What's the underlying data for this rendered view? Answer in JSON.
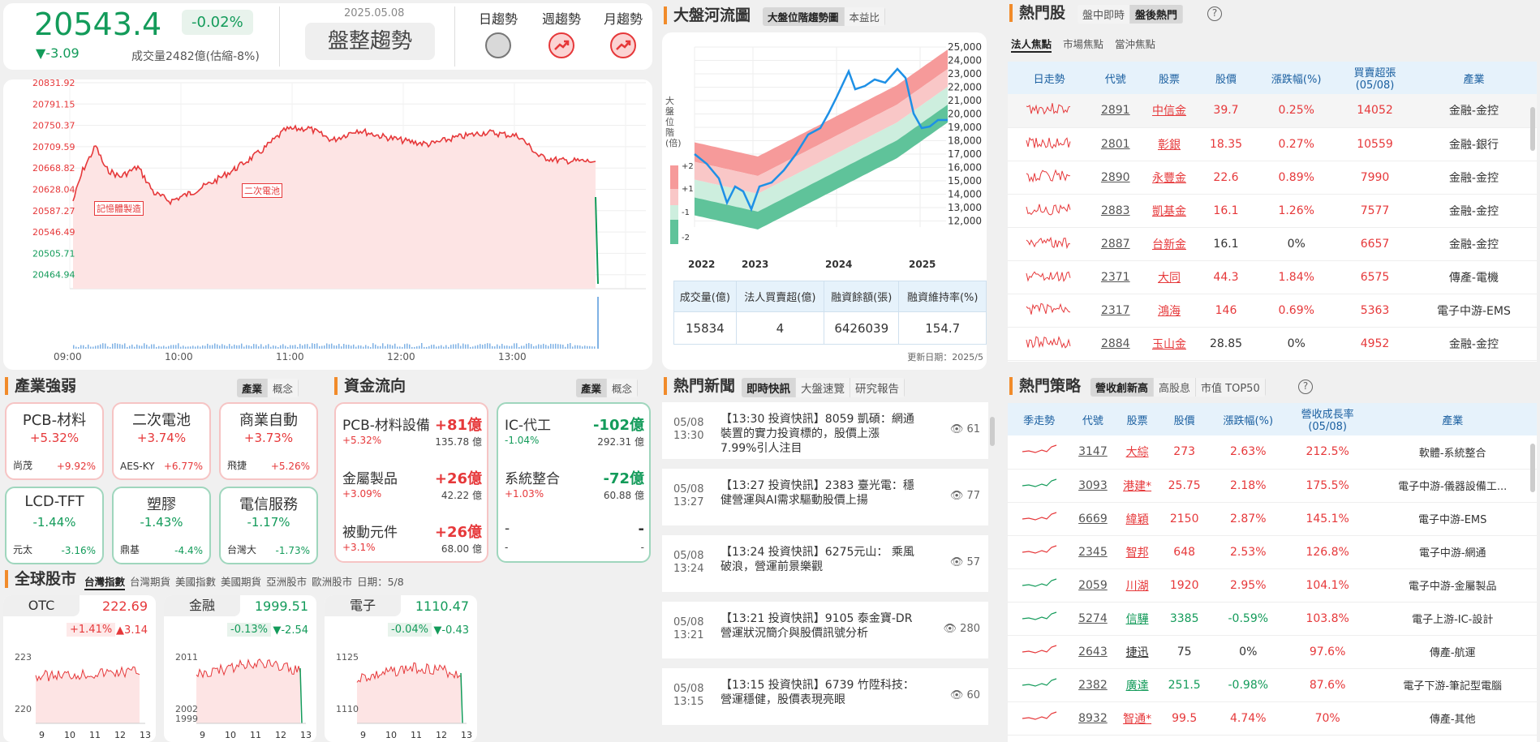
{
  "index": {
    "value": "20543.4",
    "pct": "-0.02%",
    "chg": "▼-3.09",
    "volume": "成交量2482億(估縮-8%)",
    "date": "2025.05.08",
    "trend": "盤整趨勢",
    "trend_labels": [
      "日趨勢",
      "週趨勢",
      "月趨勢"
    ]
  },
  "main_chart": {
    "y_labels": [
      "20831.92",
      "20791.15",
      "20750.37",
      "20709.59",
      "20668.82",
      "20628.04",
      "20587.27",
      "20546.49",
      "20505.71",
      "20464.94"
    ],
    "x_labels": [
      "09:00",
      "10:00",
      "11:00",
      "12:00",
      "13:00"
    ],
    "annotations": [
      "記憶體製造",
      "二次電池"
    ]
  },
  "river": {
    "title": "大盤河流圖",
    "tabs": [
      "大盤位階趨勢圖",
      "本益比"
    ],
    "y_axis_title": "大盤位階(倍)",
    "legend": [
      "+2",
      "+1",
      "-1",
      "-2"
    ],
    "y_labels": [
      "25,000",
      "24,000",
      "23,000",
      "22,000",
      "21,000",
      "20,000",
      "19,000",
      "18,000",
      "17,000",
      "16,000",
      "15,000",
      "14,000",
      "13,000",
      "12,000"
    ],
    "x_labels": [
      "2022",
      "2023",
      "2024",
      "2025"
    ],
    "table_headers": [
      "成交量(億)",
      "法人買賣超(億)",
      "融資餘額(張)",
      "融資維持率(%)"
    ],
    "table_values": [
      "15834",
      "4",
      "6426039",
      "154.7"
    ],
    "update": "更新日期：2025/5"
  },
  "hot": {
    "title": "熱門股",
    "tabs": [
      "盤中即時",
      "盤後熱門"
    ],
    "subtabs": [
      "法人焦點",
      "市場焦點",
      "當沖焦點"
    ],
    "headers": [
      "日走勢",
      "代號",
      "股票",
      "股價",
      "漲跌幅(%)",
      "買賣超張\n(05/08)",
      "產業"
    ],
    "rows": [
      [
        "2891",
        "中信金",
        "39.7",
        "0.25%",
        "14052",
        "金融-金控"
      ],
      [
        "2801",
        "彰銀",
        "18.35",
        "0.27%",
        "10559",
        "金融-銀行"
      ],
      [
        "2890",
        "永豐金",
        "22.6",
        "0.89%",
        "7990",
        "金融-金控"
      ],
      [
        "2883",
        "凱基金",
        "16.1",
        "1.26%",
        "7577",
        "金融-金控"
      ],
      [
        "2887",
        "台新金",
        "16.1",
        "0%",
        "6657",
        "金融-金控"
      ],
      [
        "2371",
        "大同",
        "44.3",
        "1.84%",
        "6575",
        "傳產-電機"
      ],
      [
        "2317",
        "鴻海",
        "146",
        "0.69%",
        "5363",
        "電子中游-EMS"
      ],
      [
        "2884",
        "玉山金",
        "28.85",
        "0%",
        "4952",
        "金融-金控"
      ]
    ]
  },
  "industry": {
    "title": "產業強弱",
    "tabs": [
      "產業",
      "概念"
    ],
    "tiles": [
      {
        "name": "PCB-材料",
        "pct": "+5.32%",
        "stock": "尚茂",
        "spct": "+9.92%"
      },
      {
        "name": "二次電池",
        "pct": "+3.74%",
        "stock": "AES-KY",
        "spct": "+6.77%"
      },
      {
        "name": "商業自動",
        "pct": "+3.73%",
        "stock": "飛捷",
        "spct": "+5.26%"
      },
      {
        "name": "LCD-TFT",
        "pct": "-1.44%",
        "stock": "元太",
        "spct": "-3.16%"
      },
      {
        "name": "塑膠",
        "pct": "-1.43%",
        "stock": "鼎基",
        "spct": "-4.4%"
      },
      {
        "name": "電信服務",
        "pct": "-1.17%",
        "stock": "台灣大",
        "spct": "-1.73%"
      }
    ]
  },
  "fund": {
    "title": "資金流向",
    "tabs": [
      "產業",
      "概念"
    ],
    "left": [
      {
        "name": "PCB-材料設備",
        "val": "+81億",
        "pct": "+5.32%",
        "amt": "135.78 億"
      },
      {
        "name": "金屬製品",
        "val": "+26億",
        "pct": "+3.09%",
        "amt": "42.22 億"
      },
      {
        "name": "被動元件",
        "val": "+26億",
        "pct": "+3.1%",
        "amt": "68.00 億"
      }
    ],
    "right": [
      {
        "name": "IC-代工",
        "val": "-102億",
        "pct": "-1.04%",
        "amt": "292.31 億"
      },
      {
        "name": "系統整合",
        "val": "-72億",
        "pct": "+1.03%",
        "amt": "60.88 億"
      },
      {
        "name": "-",
        "val": "-",
        "pct": "-",
        "amt": "-"
      }
    ]
  },
  "global": {
    "title": "全球股市",
    "tabs": [
      "台灣指數",
      "台灣期貨",
      "美國指數",
      "美國期貨",
      "亞洲股市",
      "歐洲股市"
    ],
    "date": "日期：5/8",
    "cards": [
      {
        "name": "OTC",
        "value": "222.69",
        "pct": "+1.41%",
        "chg": "▲3.14",
        "y": [
          "223",
          "220"
        ],
        "x": [
          "9",
          "10",
          "11",
          "12",
          "13"
        ]
      },
      {
        "name": "金融",
        "value": "1999.51",
        "pct": "-0.13%",
        "chg": "▼-2.54",
        "y": [
          "2011",
          "2002",
          "1999"
        ],
        "x": [
          "9",
          "10",
          "11",
          "12",
          "13"
        ]
      },
      {
        "name": "電子",
        "value": "1110.47",
        "pct": "-0.04%",
        "chg": "▼-0.43",
        "y": [
          "1125",
          "1110"
        ],
        "x": [
          "9",
          "10",
          "11",
          "12",
          "13"
        ]
      }
    ]
  },
  "news": {
    "title": "熱門新聞",
    "tabs": [
      "即時快訊",
      "大盤速覽",
      "研究報告"
    ],
    "items": [
      {
        "date": "05/08",
        "time": "13:30",
        "title": "【13:30 投資快訊】8059 凱碩：網通裝置的實力投資標的，股價上漲7.99%引人注目",
        "views": "61"
      },
      {
        "date": "05/08",
        "time": "13:27",
        "title": "【13:27 投資快訊】2383 臺光電：穩健營運與AI需求驅動股價上揚",
        "views": "77"
      },
      {
        "date": "05/08",
        "time": "13:24",
        "title": "【13:24 投資快訊】6275元山： 乘風破浪，營運前景樂觀",
        "views": "57"
      },
      {
        "date": "05/08",
        "time": "13:21",
        "title": "【13:21 投資快訊】9105 泰金寶-DR 營運狀況簡介與股價訊號分析",
        "views": "280"
      },
      {
        "date": "05/08",
        "time": "13:15",
        "title": "【13:15 投資快訊】6739 竹陞科技：營運穩健，股價表現亮眼",
        "views": "60"
      }
    ]
  },
  "strategy": {
    "title": "熱門策略",
    "tabs": [
      "營收創新高",
      "高股息",
      "市值 TOP50"
    ],
    "headers": [
      "季走勢",
      "代號",
      "股票",
      "股價",
      "漲跌幅(%)",
      "營收成長率\n(05/08)",
      "產業"
    ],
    "rows": [
      [
        "3147",
        "大綜",
        "273",
        "2.63%",
        "212.5%",
        "軟體-系統整合"
      ],
      [
        "3093",
        "港建*",
        "25.75",
        "2.18%",
        "175.5%",
        "電子中游-儀器設備工..."
      ],
      [
        "6669",
        "緯穎",
        "2150",
        "2.87%",
        "145.1%",
        "電子中游-EMS"
      ],
      [
        "2345",
        "智邦",
        "648",
        "2.53%",
        "126.8%",
        "電子中游-網通"
      ],
      [
        "2059",
        "川湖",
        "1920",
        "2.95%",
        "104.1%",
        "電子中游-金屬製品"
      ],
      [
        "5274",
        "信驊",
        "3385",
        "-0.59%",
        "103.8%",
        "電子上游-IC-設計"
      ],
      [
        "2643",
        "捷迅",
        "75",
        "0%",
        "97.6%",
        "傳產-航運"
      ],
      [
        "2382",
        "廣達",
        "251.5",
        "-0.98%",
        "87.6%",
        "電子下游-筆記型電腦"
      ],
      [
        "8932",
        "智通*",
        "99.5",
        "4.74%",
        "70%",
        "傳產-其他"
      ]
    ]
  },
  "colors": {
    "up": "#e6383a",
    "down": "#139b5a",
    "accent": "#f18b2a",
    "header_bg": "#e6f2fb"
  }
}
